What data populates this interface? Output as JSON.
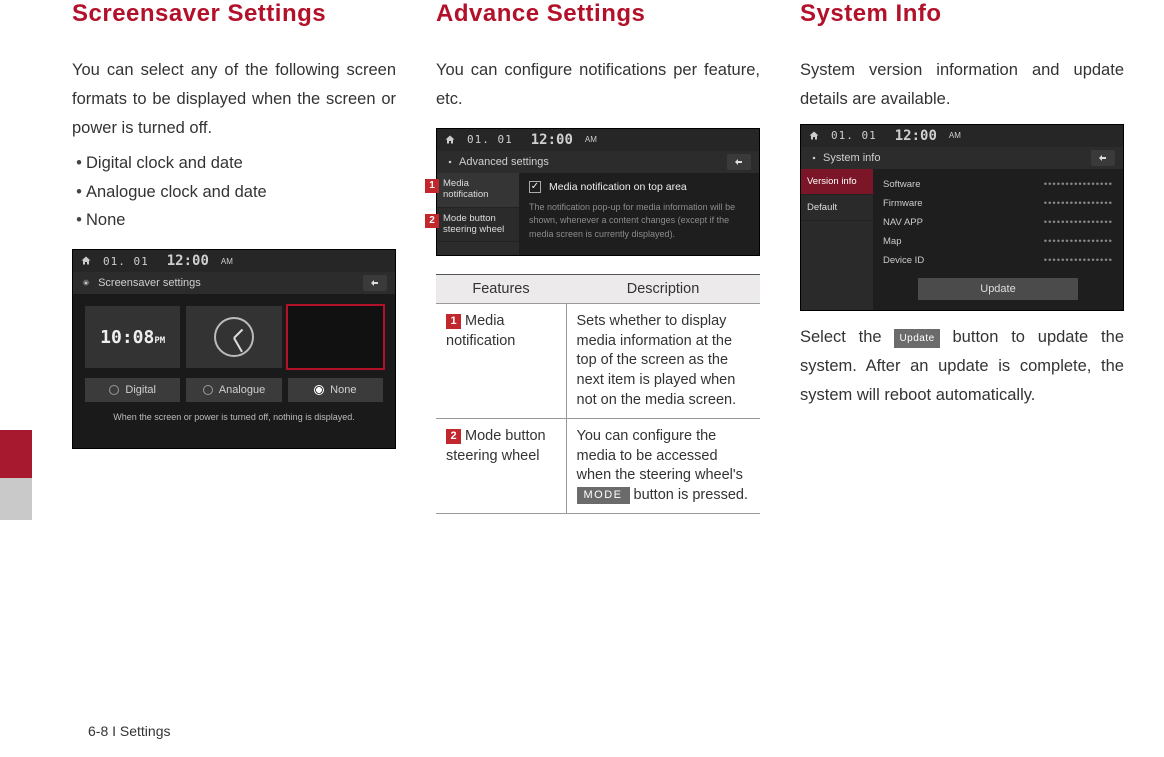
{
  "footer": "6-8 I Settings",
  "col1": {
    "heading": "Screensaver Settings",
    "intro": "You can select any of the following screen formats to be displayed when the screen or power is turned off.",
    "bullets": [
      "Digital clock and date",
      "Analogue clock and date",
      "None"
    ],
    "mock": {
      "date": "01. 01",
      "time": "12:00",
      "ampm": "AM",
      "title": "Screensaver settings",
      "digital_time": "10:08",
      "digital_ampm": "PM",
      "opts": [
        "Digital",
        "Analogue",
        "None"
      ],
      "footnote": "When the screen or power is turned off, nothing is displayed."
    }
  },
  "col2": {
    "heading": "Advance Settings",
    "intro": "You can configure notifications per feature, etc.",
    "mock": {
      "date": "01. 01",
      "time": "12:00",
      "ampm": "AM",
      "title": "Advanced settings",
      "side1": "Media notification",
      "side2": "Mode button steering wheel",
      "check_label": "Media notification on top area",
      "desc": "The notification pop-up for media information will be shown, whenever a content changes (except if the media screen is currently displayed)."
    },
    "table": {
      "h1": "Features",
      "h2": "Description",
      "r1f": "Media notification",
      "r1d": "Sets whether to display media information at the top of the screen as the next item is played when not on the media screen.",
      "r2f": "Mode button steering wheel",
      "r2d_a": "You can configure the media to be accessed when the steering wheel's ",
      "r2d_chip": "MODE",
      "r2d_b": " button is pressed."
    }
  },
  "col3": {
    "heading": "System Info",
    "intro": "System version information and update details are available.",
    "mock": {
      "date": "01. 01",
      "time": "12:00",
      "ampm": "AM",
      "title": "System info",
      "side1": "Version info",
      "side2": "Default",
      "rows": [
        "Software",
        "Firmware",
        "NAV APP",
        "Map",
        "Device ID"
      ],
      "update": "Update"
    },
    "after_a": "Select the ",
    "after_chip": "Update",
    "after_b": " button to update the system. After an update is complete, the system will reboot automatically."
  }
}
